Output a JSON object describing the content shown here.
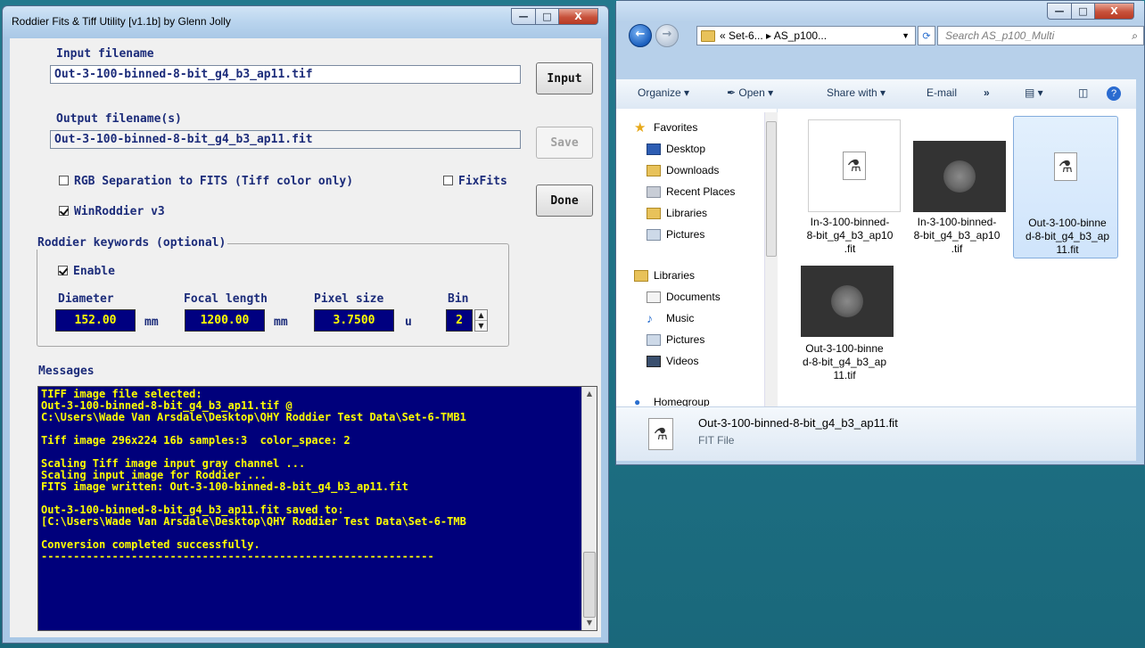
{
  "roddier_window": {
    "title": "Roddier Fits & Tiff Utility [v1.1b]  by Glenn Jolly",
    "input_label": "Input filename",
    "input_value": "Out-3-100-binned-8-bit_g4_b3_ap11.tif",
    "input_button": "Input",
    "output_label": "Output filename(s)",
    "output_value": "Out-3-100-binned-8-bit_g4_b3_ap11.fit",
    "save_button": "Save",
    "rgb_separation_label": "RGB Separation to FITS (Tiff color only)",
    "rgb_separation_checked": false,
    "fixfits_label": "FixFits",
    "fixfits_checked": false,
    "winroddier_label": "WinRoddier v3",
    "winroddier_checked": true,
    "done_button": "Done",
    "keywords_group_label": "Roddier keywords (optional)",
    "enable_label": "Enable",
    "enable_checked": true,
    "diameter_label": "Diameter",
    "diameter_value": "152.00",
    "diameter_unit": "mm",
    "focal_label": "Focal length",
    "focal_value": "1200.00",
    "focal_unit": "mm",
    "pixel_label": "Pixel size",
    "pixel_value": "3.7500",
    "pixel_unit": "u",
    "bin_label": "Bin",
    "bin_value": "2",
    "messages_label": "Messages",
    "messages": [
      "TIFF image file selected:",
      "Out-3-100-binned-8-bit_g4_b3_ap11.tif @",
      "C:\\Users\\Wade Van Arsdale\\Desktop\\QHY Roddier Test Data\\Set-6-TMB1",
      "",
      "Tiff image 296x224 16b samples:3  color_space: 2",
      "",
      "Scaling Tiff image input gray channel ...",
      "Scaling input image for Roddier ...",
      "FITS image written: Out-3-100-binned-8-bit_g4_b3_ap11.fit",
      "",
      "Out-3-100-binned-8-bit_g4_b3_ap11.fit saved to:",
      "[C:\\Users\\Wade Van Arsdale\\Desktop\\QHY Roddier Test Data\\Set-6-TMB",
      "",
      "Conversion completed successfully.",
      "-------------------------------------------------------------"
    ]
  },
  "explorer_window": {
    "breadcrumb": "« Set-6... ▸ AS_p100...",
    "search_placeholder": "Search AS_p100_Multi",
    "toolbar": {
      "organize": "Organize ▾",
      "open": "Open ▾",
      "share_with": "Share with ▾",
      "email": "E-mail",
      "more": "»"
    },
    "nav": {
      "favorites": "Favorites",
      "desktop": "Desktop",
      "downloads": "Downloads",
      "recent_places": "Recent Places",
      "libraries_fav": "Libraries",
      "pictures_fav": "Pictures",
      "libraries": "Libraries",
      "documents": "Documents",
      "music": "Music",
      "pictures": "Pictures",
      "videos": "Videos",
      "homegroup": "Homegroup"
    },
    "files": [
      {
        "name": "In-3-100-binned-8-bit_g4_b3_ap10.fit",
        "lines": [
          "In-3-100-binned-",
          "8-bit_g4_b3_ap10",
          ".fit"
        ]
      },
      {
        "name": "In-3-100-binned-8-bit_g4_b3_ap10.tif",
        "lines": [
          "In-3-100-binned-",
          "8-bit_g4_b3_ap10",
          ".tif"
        ]
      },
      {
        "name": "Out-3-100-binned-8-bit_g4_b3_ap11.fit",
        "lines": [
          "Out-3-100-binne",
          "d-8-bit_g4_b3_ap",
          "11.fit"
        ]
      },
      {
        "name": "Out-3-100-binned-8-bit_g4_b3_ap11.tif",
        "lines": [
          "Out-3-100-binne",
          "d-8-bit_g4_b3_ap",
          "11.tif"
        ]
      }
    ],
    "details_name": "Out-3-100-binned-8-bit_g4_b3_ap11.fit",
    "details_type": "FIT File"
  }
}
